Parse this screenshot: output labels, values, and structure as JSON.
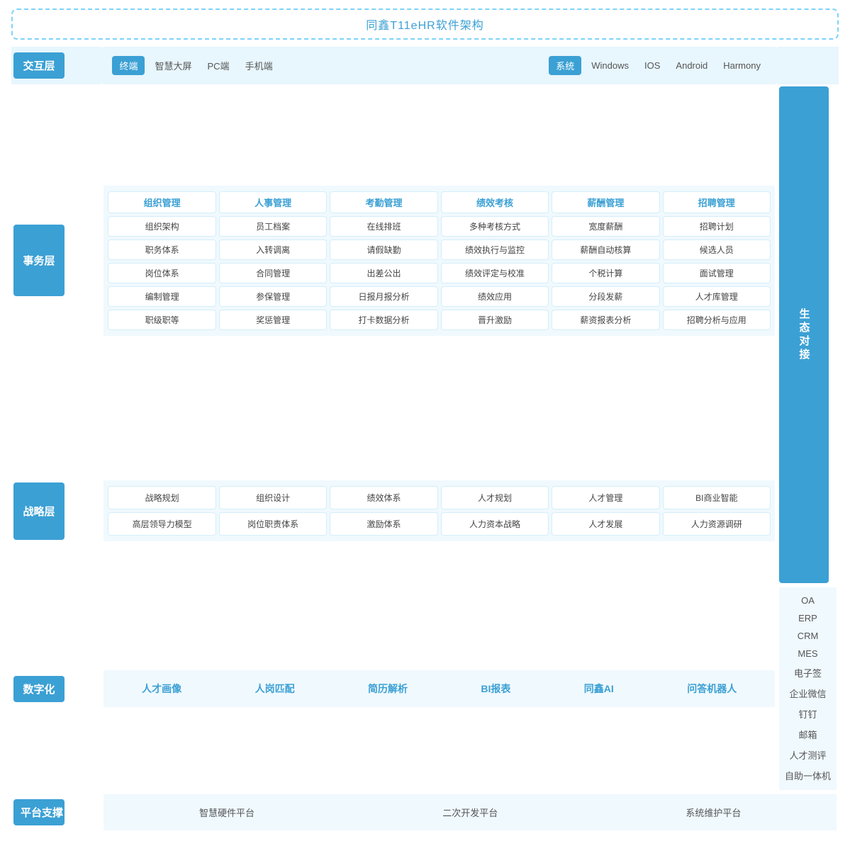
{
  "title": "同鑫T11eHR软件架构",
  "interact_layer": {
    "label": "交互层",
    "terminal_label": "终端",
    "terminal_items": [
      "智慧大屏",
      "PC端",
      "手机端"
    ],
    "system_label": "系统",
    "system_items": [
      "Windows",
      "IOS",
      "Android",
      "Harmony"
    ]
  },
  "business_layer": {
    "label": "事务层",
    "modules": [
      {
        "header": "组织管理",
        "items": [
          "组织架构",
          "职务体系",
          "岗位体系",
          "编制管理",
          "职级职等"
        ]
      },
      {
        "header": "人事管理",
        "items": [
          "员工档案",
          "入转调离",
          "合同管理",
          "参保管理",
          "奖惩管理"
        ]
      },
      {
        "header": "考勤管理",
        "items": [
          "在线排班",
          "请假缺勤",
          "出差公出",
          "日报月报分析",
          "打卡数据分析"
        ]
      },
      {
        "header": "绩效考核",
        "items": [
          "多种考核方式",
          "绩效执行与监控",
          "绩效评定与校准",
          "绩效应用",
          "晋升激励"
        ]
      },
      {
        "header": "薪酬管理",
        "items": [
          "宽度薪酬",
          "薪酬自动核算",
          "个税计算",
          "分段发薪",
          "薪资报表分析"
        ]
      },
      {
        "header": "招聘管理",
        "items": [
          "招聘计划",
          "候选人员",
          "面试管理",
          "人才库管理",
          "招聘分析与应用"
        ]
      }
    ]
  },
  "ecology": {
    "label": "生态对接",
    "items": [
      "OA",
      "ERP",
      "CRM",
      "MES",
      "电子签",
      "企业微信",
      "钉钉",
      "邮箱",
      "人才测评",
      "自助一体机"
    ]
  },
  "strategy_layer": {
    "label": "战略层",
    "columns": [
      {
        "items": [
          "战略规划",
          "高层领导力模型"
        ]
      },
      {
        "items": [
          "组织设计",
          "岗位职责体系"
        ]
      },
      {
        "items": [
          "绩效体系",
          "激励体系"
        ]
      },
      {
        "items": [
          "人才规划",
          "人力资本战略"
        ]
      },
      {
        "items": [
          "人才管理",
          "人才发展"
        ]
      },
      {
        "items": [
          "BI商业智能",
          "人力资源调研"
        ]
      }
    ]
  },
  "digital_layer": {
    "label": "数字化",
    "items": [
      "人才画像",
      "人岗匹配",
      "简历解析",
      "BI报表",
      "同鑫AI",
      "问答机器人"
    ]
  },
  "platform_layer": {
    "label": "平台支撑",
    "items": [
      "智慧硬件平台",
      "二次开发平台",
      "系统维护平台"
    ]
  }
}
